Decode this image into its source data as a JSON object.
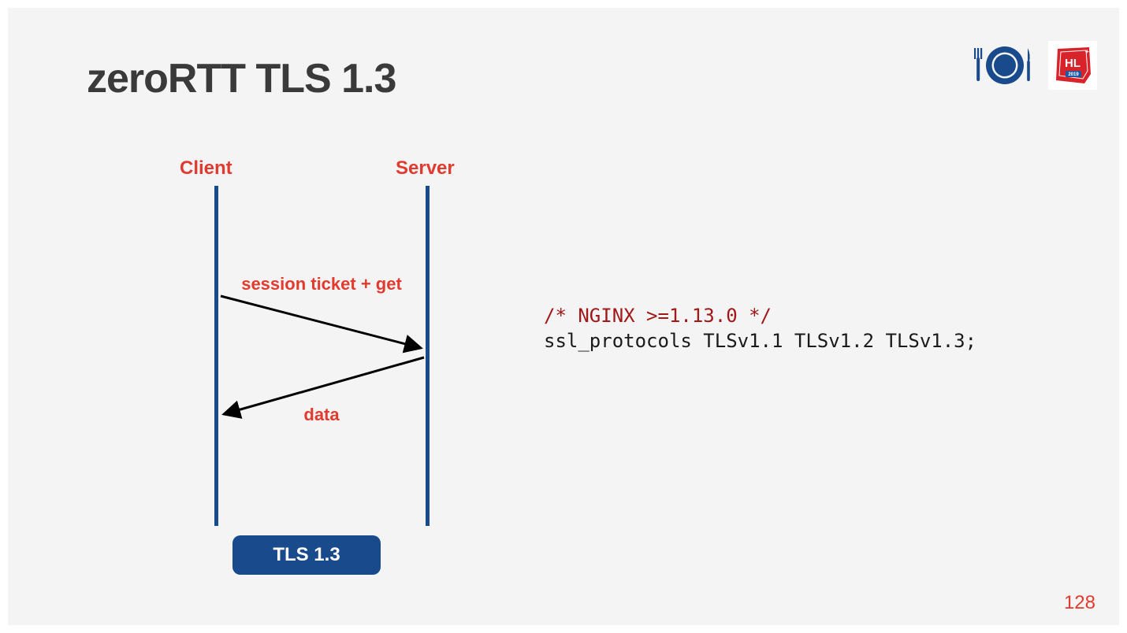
{
  "title": "zeroRTT TLS 1.3",
  "diagram": {
    "client_label": "Client",
    "server_label": "Server",
    "msg1": "session ticket + get",
    "msg2": "data",
    "protocol_badge": "TLS 1.3"
  },
  "code": {
    "comment": "/* NGINX >=1.13.0 */",
    "line1": "ssl_protocols TLSv1.1 TLSv1.2 TLSv1.3;"
  },
  "page_number": "128",
  "logos": {
    "plate": "plate-and-cutlery-icon",
    "hl": "HL",
    "hl_year": "2019"
  },
  "colors": {
    "accent_red": "#e13a2f",
    "accent_blue": "#194a8b",
    "bg": "#f4f4f4"
  }
}
